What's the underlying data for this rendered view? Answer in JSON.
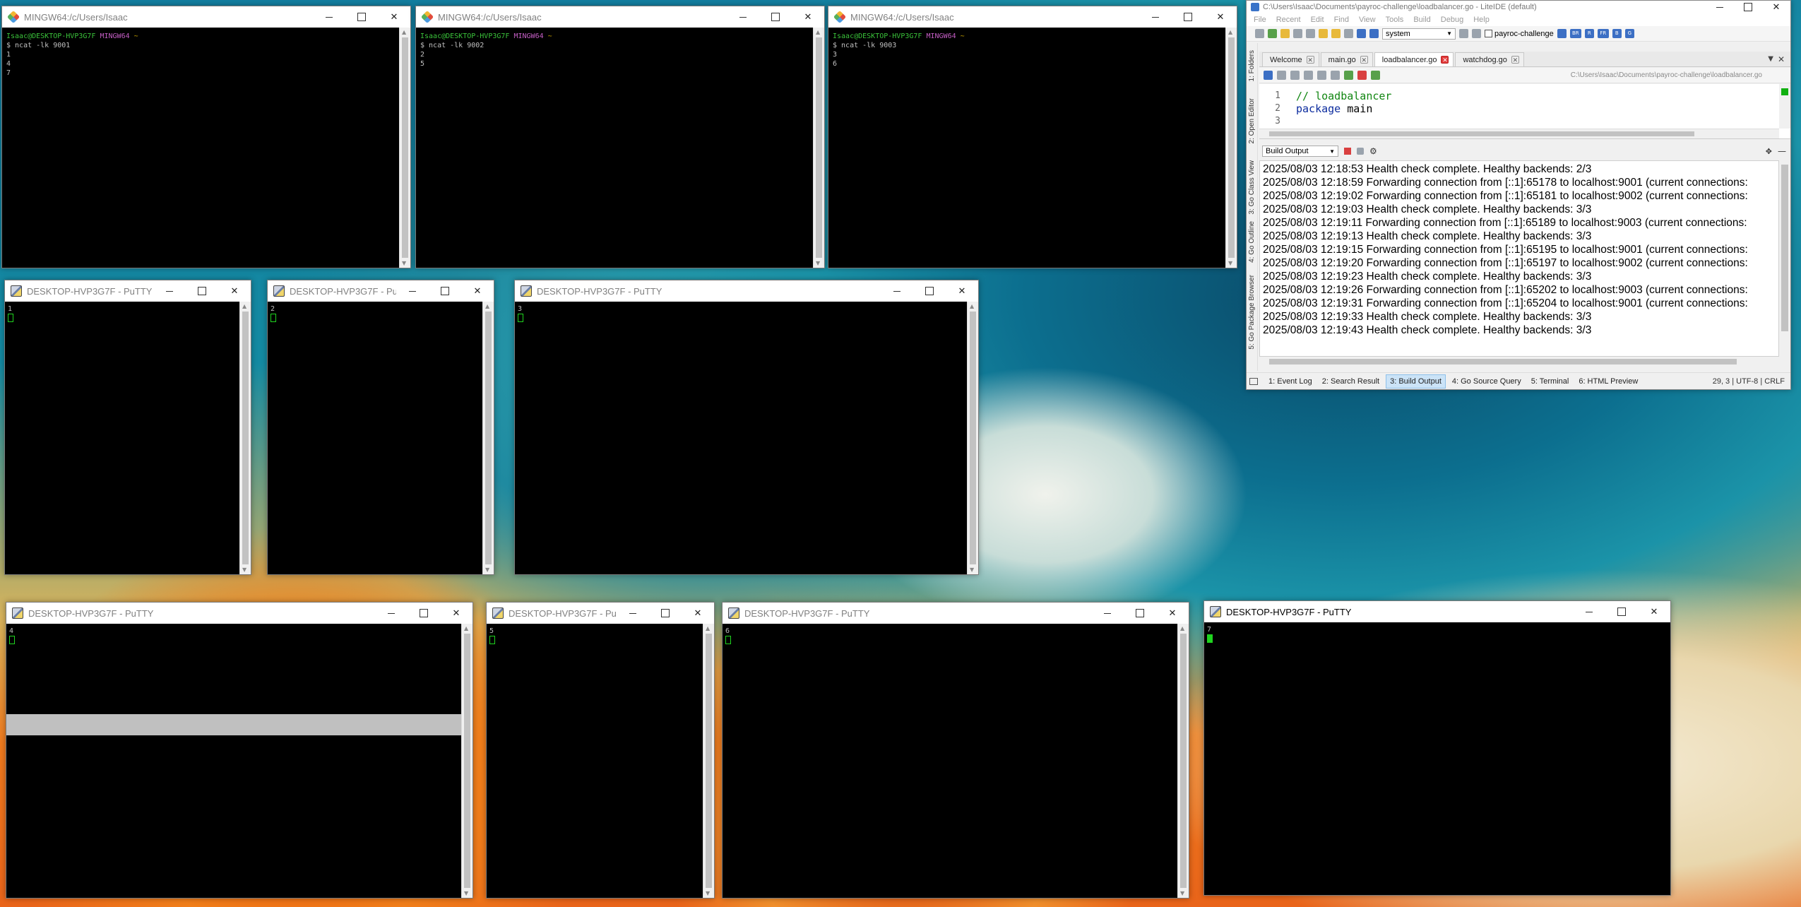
{
  "mingw_windows": [
    {
      "title": "MINGW64:/c/Users/Isaac",
      "prompt_user": "Isaac@DESKTOP-HVP3G7F",
      "prompt_sys": "MINGW64",
      "prompt_dir": "~",
      "command": "$ ncat -lk 9001",
      "output": "1\n4\n7"
    },
    {
      "title": "MINGW64:/c/Users/Isaac",
      "prompt_user": "Isaac@DESKTOP-HVP3G7F",
      "prompt_sys": "MINGW64",
      "prompt_dir": "~",
      "command": "$ ncat -lk 9002",
      "output": "2\n5"
    },
    {
      "title": "MINGW64:/c/Users/Isaac",
      "prompt_user": "Isaac@DESKTOP-HVP3G7F",
      "prompt_sys": "MINGW64",
      "prompt_dir": "~",
      "command": "$ ncat -lk 9003",
      "output": "3\n6"
    }
  ],
  "putty_windows": [
    {
      "title": "DESKTOP-HVP3G7F - PuTTY",
      "output": "1"
    },
    {
      "title": "DESKTOP-HVP3G7F - PuTTY",
      "output": "2"
    },
    {
      "title": "DESKTOP-HVP3G7F - PuTTY",
      "output": "3"
    },
    {
      "title": "DESKTOP-HVP3G7F - PuTTY",
      "output": "4"
    },
    {
      "title": "DESKTOP-HVP3G7F - PuTTY",
      "output": "5"
    },
    {
      "title": "DESKTOP-HVP3G7F - PuTTY",
      "output": "6"
    },
    {
      "title": "DESKTOP-HVP3G7F - PuTTY",
      "output": "7"
    }
  ],
  "liteide": {
    "title": "C:\\Users\\Isaac\\Documents\\payroc-challenge\\loadbalancer.go - LiteIDE (default)",
    "menu": [
      "File",
      "Recent",
      "Edit",
      "Find",
      "View",
      "Tools",
      "Build",
      "Debug",
      "Help"
    ],
    "env_select": "system",
    "project_check_label": "payroc-challenge",
    "build_buttons": [
      "BR",
      "R",
      "FR",
      "B",
      "G"
    ],
    "side_rail": [
      "1: Folders",
      "2: Open Editor",
      "3: Go Class View",
      "4: Go Outline",
      "5: Go Package Browser"
    ],
    "tabs": [
      "Welcome",
      "main.go",
      "loadbalancer.go",
      "watchdog.go"
    ],
    "active_tab": "loadbalancer.go",
    "path": "C:\\Users\\Isaac\\Documents\\payroc-challenge\\loadbalancer.go",
    "line_numbers": "1\n2\n3",
    "code": {
      "line1": "// loadbalancer",
      "line2_keyword": "package",
      "line2_rest": " main"
    },
    "output_select": "Build Output",
    "output_lines": "2025/08/03 12:18:53 Health check complete. Healthy backends: 2/3\n2025/08/03 12:18:59 Forwarding connection from [::1]:65178 to localhost:9001 (current connections:\n2025/08/03 12:19:02 Forwarding connection from [::1]:65181 to localhost:9002 (current connections:\n2025/08/03 12:19:03 Health check complete. Healthy backends: 3/3\n2025/08/03 12:19:11 Forwarding connection from [::1]:65189 to localhost:9003 (current connections:\n2025/08/03 12:19:13 Health check complete. Healthy backends: 3/3\n2025/08/03 12:19:15 Forwarding connection from [::1]:65195 to localhost:9001 (current connections:\n2025/08/03 12:19:20 Forwarding connection from [::1]:65197 to localhost:9002 (current connections:\n2025/08/03 12:19:23 Health check complete. Healthy backends: 3/3\n2025/08/03 12:19:26 Forwarding connection from [::1]:65202 to localhost:9003 (current connections:\n2025/08/03 12:19:31 Forwarding connection from [::1]:65204 to localhost:9001 (current connections:\n2025/08/03 12:19:33 Health check complete. Healthy backends: 3/3\n2025/08/03 12:19:43 Health check complete. Healthy backends: 3/3",
    "status_tabs": [
      "1: Event Log",
      "2: Search Result",
      "3: Build Output",
      "4: Go Source Query",
      "5: Terminal",
      "6: HTML Preview"
    ],
    "status_active": "3: Build Output",
    "status_pos": "29, 3 | UTF-8 | CRLF"
  }
}
